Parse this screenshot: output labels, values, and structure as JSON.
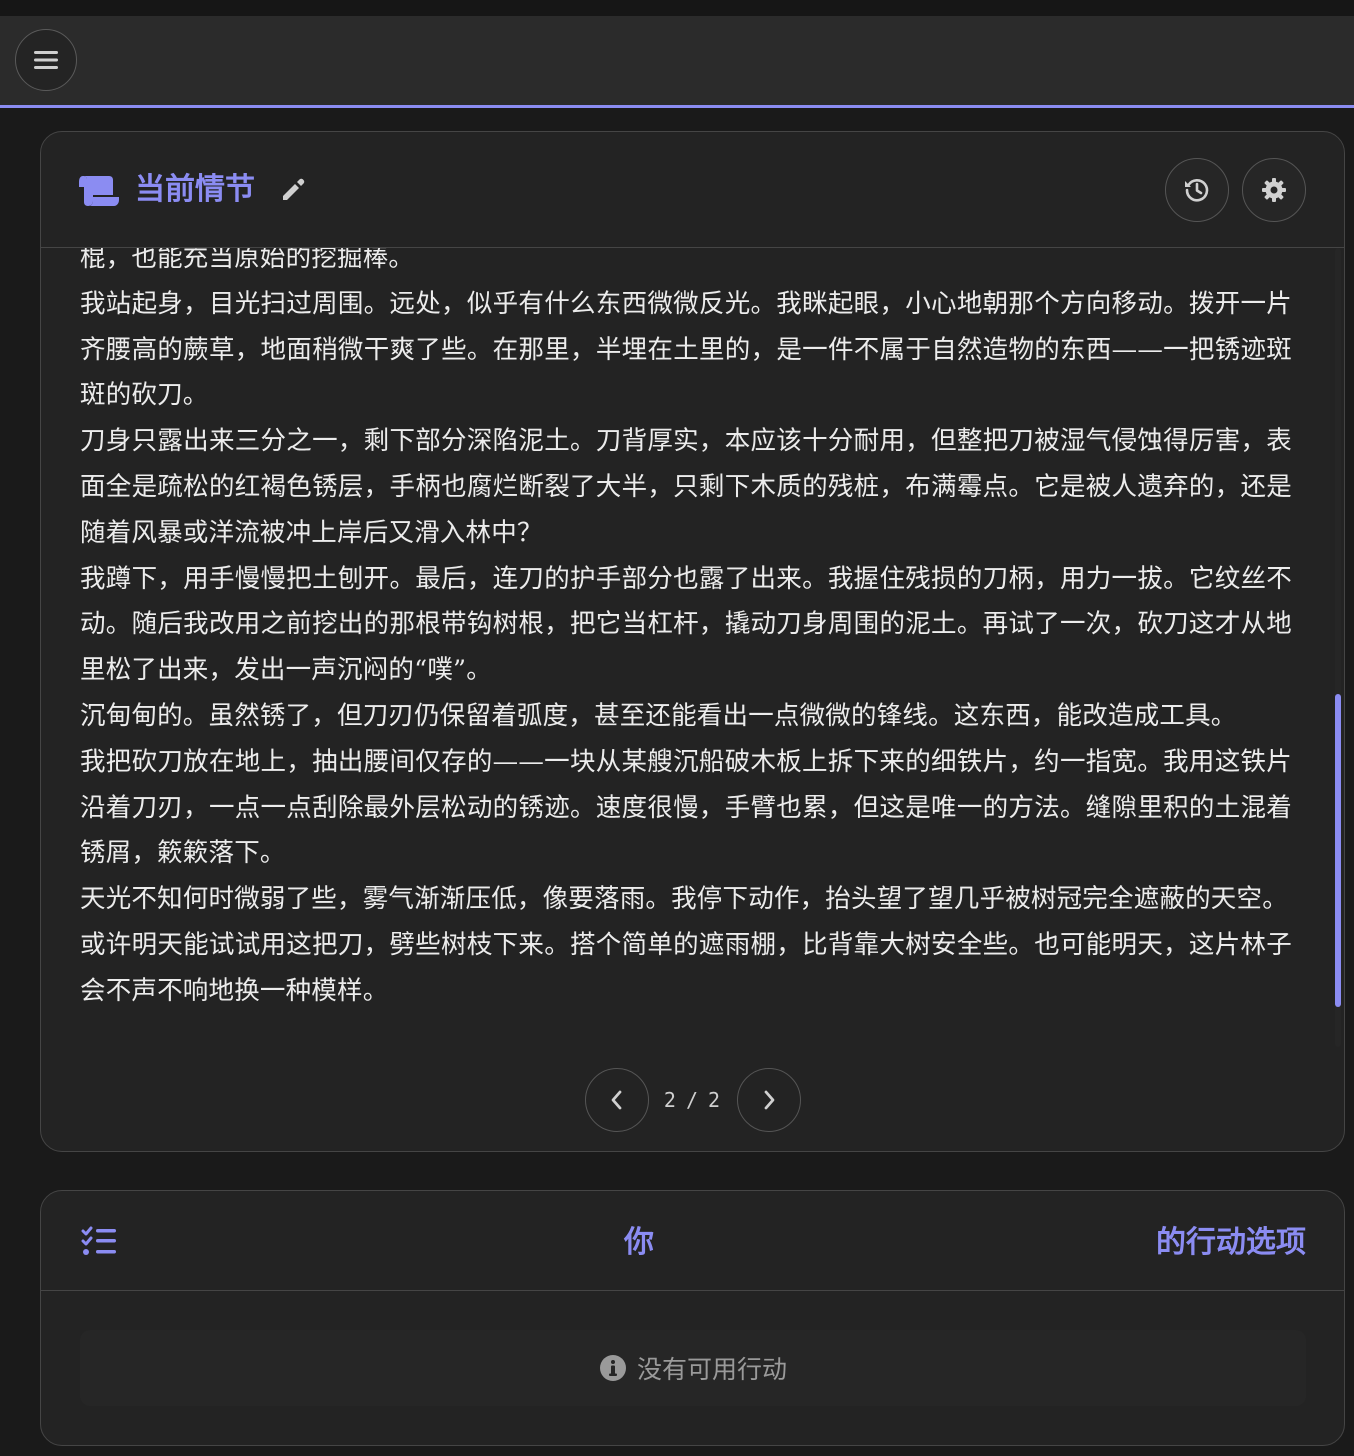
{
  "colors": {
    "accent": "#8b8cf2",
    "background": "#1a1a1a",
    "card": "#232323",
    "text": "#ececec"
  },
  "topbar": {
    "menu_icon": "menu-icon"
  },
  "story": {
    "title": "当前情节",
    "title_icon": "scroll-icon",
    "edit_icon": "pencil-icon",
    "history_icon": "history-icon",
    "settings_icon": "gear-icon",
    "paragraphs": [
      "棍，也能充当原始的挖掘棒。",
      "我站起身，目光扫过周围。远处，似乎有什么东西微微反光。我眯起眼，小心地朝那个方向移动。拨开一片齐腰高的蕨草，地面稍微干爽了些。在那里，半埋在土里的，是一件不属于自然造物的东西——一把锈迹斑斑的砍刀。",
      "刀身只露出来三分之一，剩下部分深陷泥土。刀背厚实，本应该十分耐用，但整把刀被湿气侵蚀得厉害，表面全是疏松的红褐色锈层，手柄也腐烂断裂了大半，只剩下木质的残桩，布满霉点。它是被人遗弃的，还是随着风暴或洋流被冲上岸后又滑入林中？",
      "我蹲下，用手慢慢把土刨开。最后，连刀的护手部分也露了出来。我握住残损的刀柄，用力一拔。它纹丝不动。随后我改用之前挖出的那根带钩树根，把它当杠杆，撬动刀身周围的泥土。再试了一次，砍刀这才从地里松了出来，发出一声沉闷的“噗”。",
      "沉甸甸的。虽然锈了，但刀刃仍保留着弧度，甚至还能看出一点微微的锋线。这东西，能改造成工具。",
      "我把砍刀放在地上，抽出腰间仅存的——一块从某艘沉船破木板上拆下来的细铁片，约一指宽。我用这铁片沿着刀刃，一点一点刮除最外层松动的锈迹。速度很慢，手臂也累，但这是唯一的方法。缝隙里积的土混着锈屑，簌簌落下。",
      "天光不知何时微弱了些，雾气渐渐压低，像要落雨。我停下动作，抬头望了望几乎被树冠完全遮蔽的天空。",
      "或许明天能试试用这把刀，劈些树枝下来。搭个简单的遮雨棚，比背靠大树安全些。也可能明天，这片林子会不声不响地换一种模样。"
    ],
    "pager": {
      "current": "2",
      "separator": "/",
      "total": "2",
      "prev_icon": "chevron-left-icon",
      "next_icon": "chevron-right-icon"
    }
  },
  "actions": {
    "title_part1": "你",
    "title_part2": "的行动选项",
    "title_icon": "list-check-icon",
    "empty_icon": "info-icon",
    "empty_text": "没有可用行动"
  }
}
